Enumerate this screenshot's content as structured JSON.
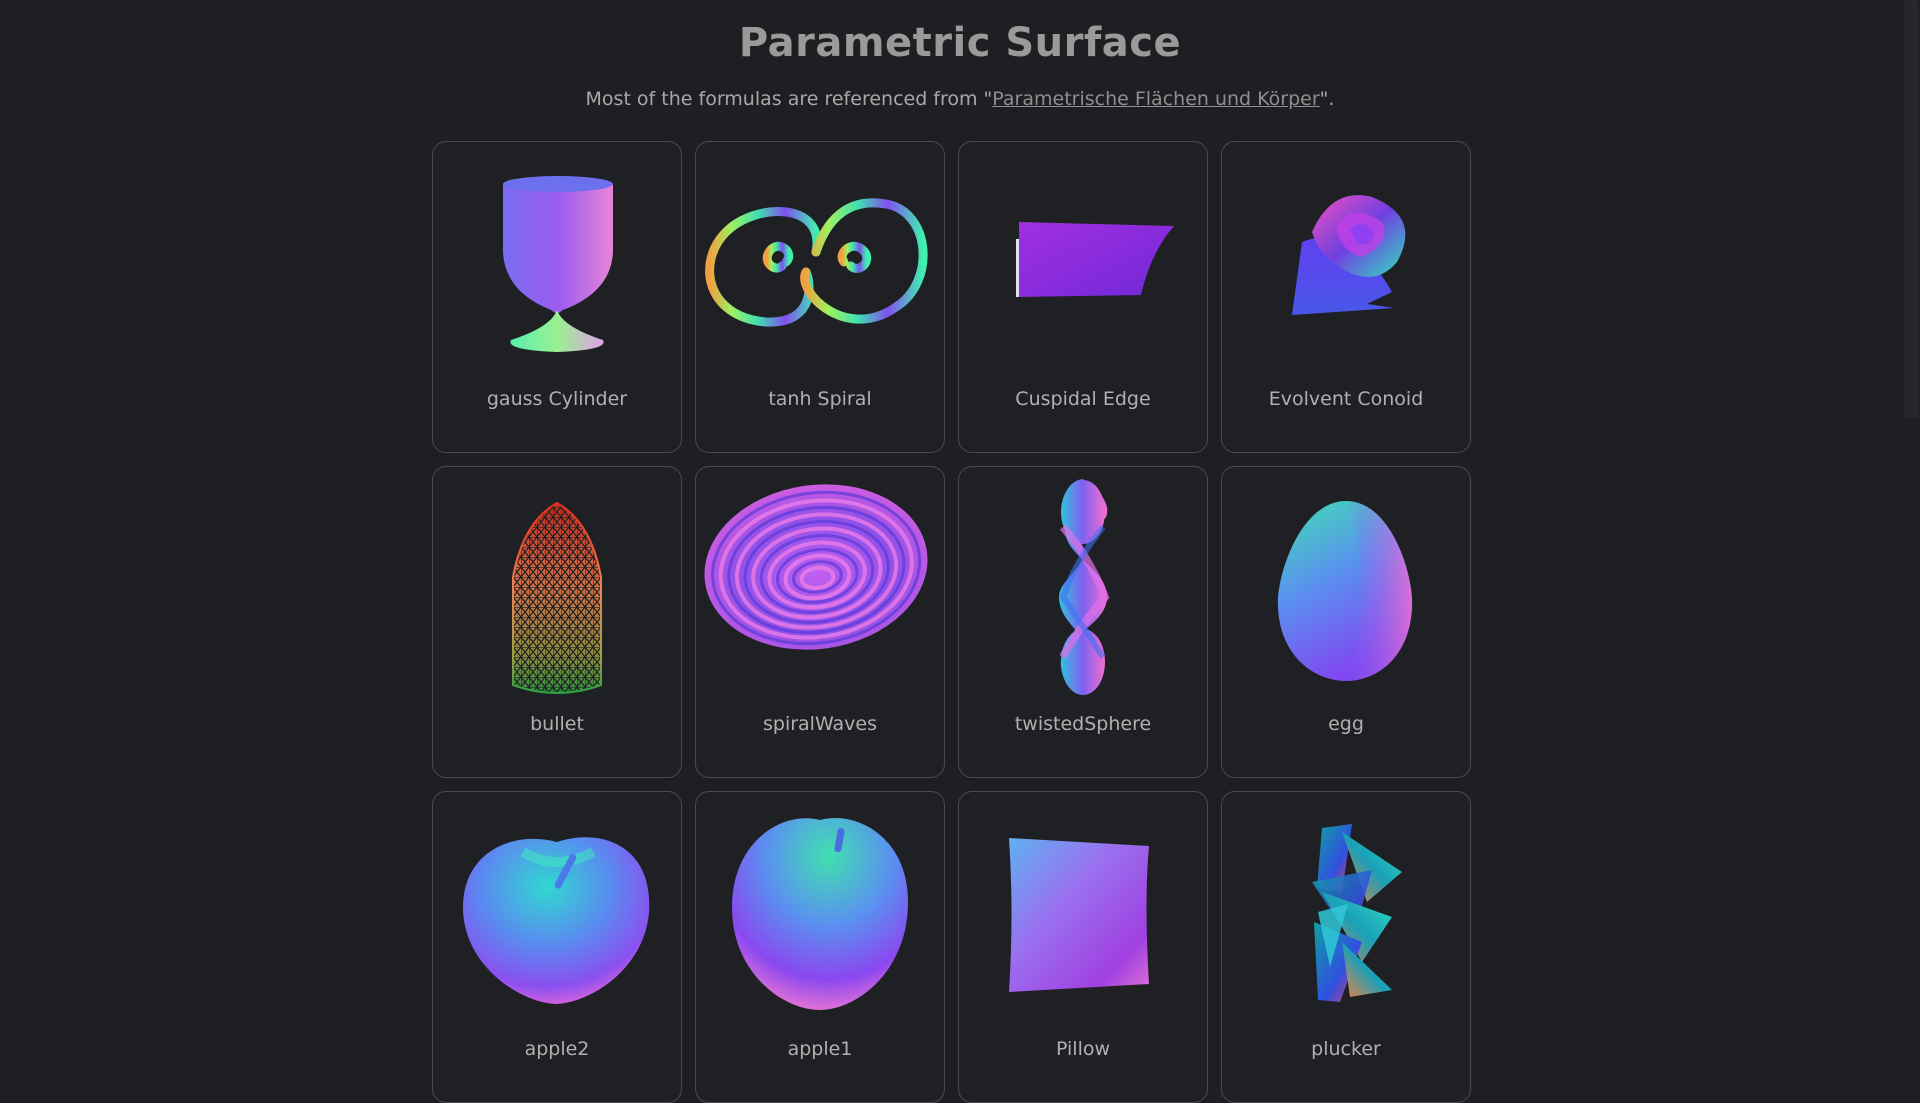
{
  "header": {
    "title": "Parametric Surface",
    "subtitle_prefix": "Most of the formulas are referenced from \"",
    "subtitle_link": "Parametrische Flächen und Körper",
    "subtitle_suffix": "\"."
  },
  "cards": [
    {
      "label": "gauss Cylinder",
      "icon": "gauss-cylinder-surface-icon"
    },
    {
      "label": "tanh Spiral",
      "icon": "tanh-spiral-surface-icon"
    },
    {
      "label": "Cuspidal Edge",
      "icon": "cuspidal-edge-surface-icon"
    },
    {
      "label": "Evolvent Conoid",
      "icon": "evolvent-conoid-surface-icon"
    },
    {
      "label": "bullet",
      "icon": "bullet-wireframe-icon"
    },
    {
      "label": "spiralWaves",
      "icon": "spiral-waves-surface-icon"
    },
    {
      "label": "twistedSphere",
      "icon": "twisted-sphere-surface-icon"
    },
    {
      "label": "egg",
      "icon": "egg-surface-icon"
    },
    {
      "label": "apple2",
      "icon": "apple2-surface-icon"
    },
    {
      "label": "apple1",
      "icon": "apple1-surface-icon"
    },
    {
      "label": "Pillow",
      "icon": "pillow-surface-icon"
    },
    {
      "label": "plucker",
      "icon": "plucker-surface-icon"
    }
  ],
  "colors": {
    "background": "#1e1f23",
    "card_border": "#4a4b50",
    "text": "#b0b0b0"
  }
}
